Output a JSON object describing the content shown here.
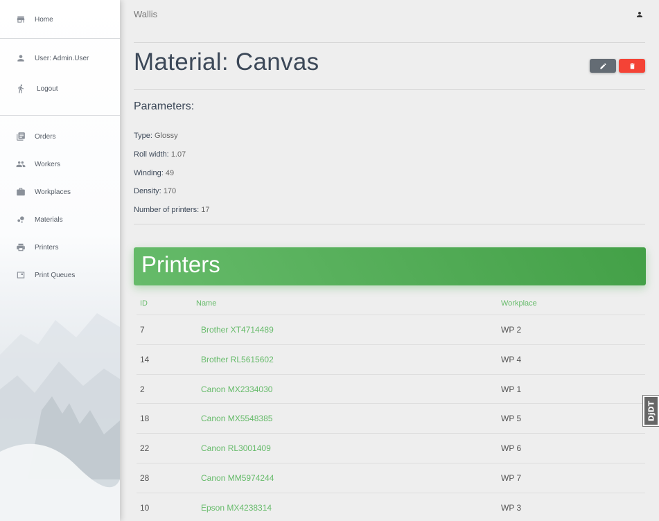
{
  "sidebar": {
    "items": [
      {
        "label": "Home",
        "icon": "store-icon"
      },
      {
        "label": "User: Admin.User",
        "icon": "person-icon"
      },
      {
        "label": "Logout",
        "icon": "run-icon"
      },
      {
        "label": "Orders",
        "icon": "library-books-icon"
      },
      {
        "label": "Workers",
        "icon": "people-icon"
      },
      {
        "label": "Workplaces",
        "icon": "briefcase-icon"
      },
      {
        "label": "Materials",
        "icon": "bubble-chart-icon"
      },
      {
        "label": "Printers",
        "icon": "print-icon"
      },
      {
        "label": "Print Queues",
        "icon": "queue-icon"
      }
    ]
  },
  "header": {
    "brand": "Wallis",
    "user_icon": "person-icon"
  },
  "page": {
    "title": "Material: Canvas",
    "edit_icon": "pencil-icon",
    "delete_icon": "trash-icon"
  },
  "parameters": {
    "title": "Parameters:",
    "items": [
      {
        "label": "Type:",
        "value": "Glossy"
      },
      {
        "label": "Roll width:",
        "value": "1.07"
      },
      {
        "label": "Winding:",
        "value": "49"
      },
      {
        "label": "Density:",
        "value": "170"
      },
      {
        "label": "Number of printers:",
        "value": "17"
      }
    ]
  },
  "printers": {
    "title": "Printers",
    "columns": [
      "ID",
      "Name",
      "Workplace"
    ],
    "rows": [
      {
        "id": "7",
        "name": "Brother XT4714489",
        "workplace": "WP 2"
      },
      {
        "id": "14",
        "name": "Brother RL5615602",
        "workplace": "WP 4"
      },
      {
        "id": "2",
        "name": "Canon MX2334030",
        "workplace": "WP 1"
      },
      {
        "id": "18",
        "name": "Canon MX5548385",
        "workplace": "WP 5"
      },
      {
        "id": "22",
        "name": "Canon RL3001409",
        "workplace": "WP 6"
      },
      {
        "id": "28",
        "name": "Canon MM5974244",
        "workplace": "WP 7"
      },
      {
        "id": "10",
        "name": "Epson MX4238314",
        "workplace": "WP 3"
      }
    ]
  },
  "badge": {
    "text": "DjDT"
  },
  "colors": {
    "accent_green": "#4caf50",
    "danger": "#f44336",
    "edit_gray": "#646c74"
  }
}
